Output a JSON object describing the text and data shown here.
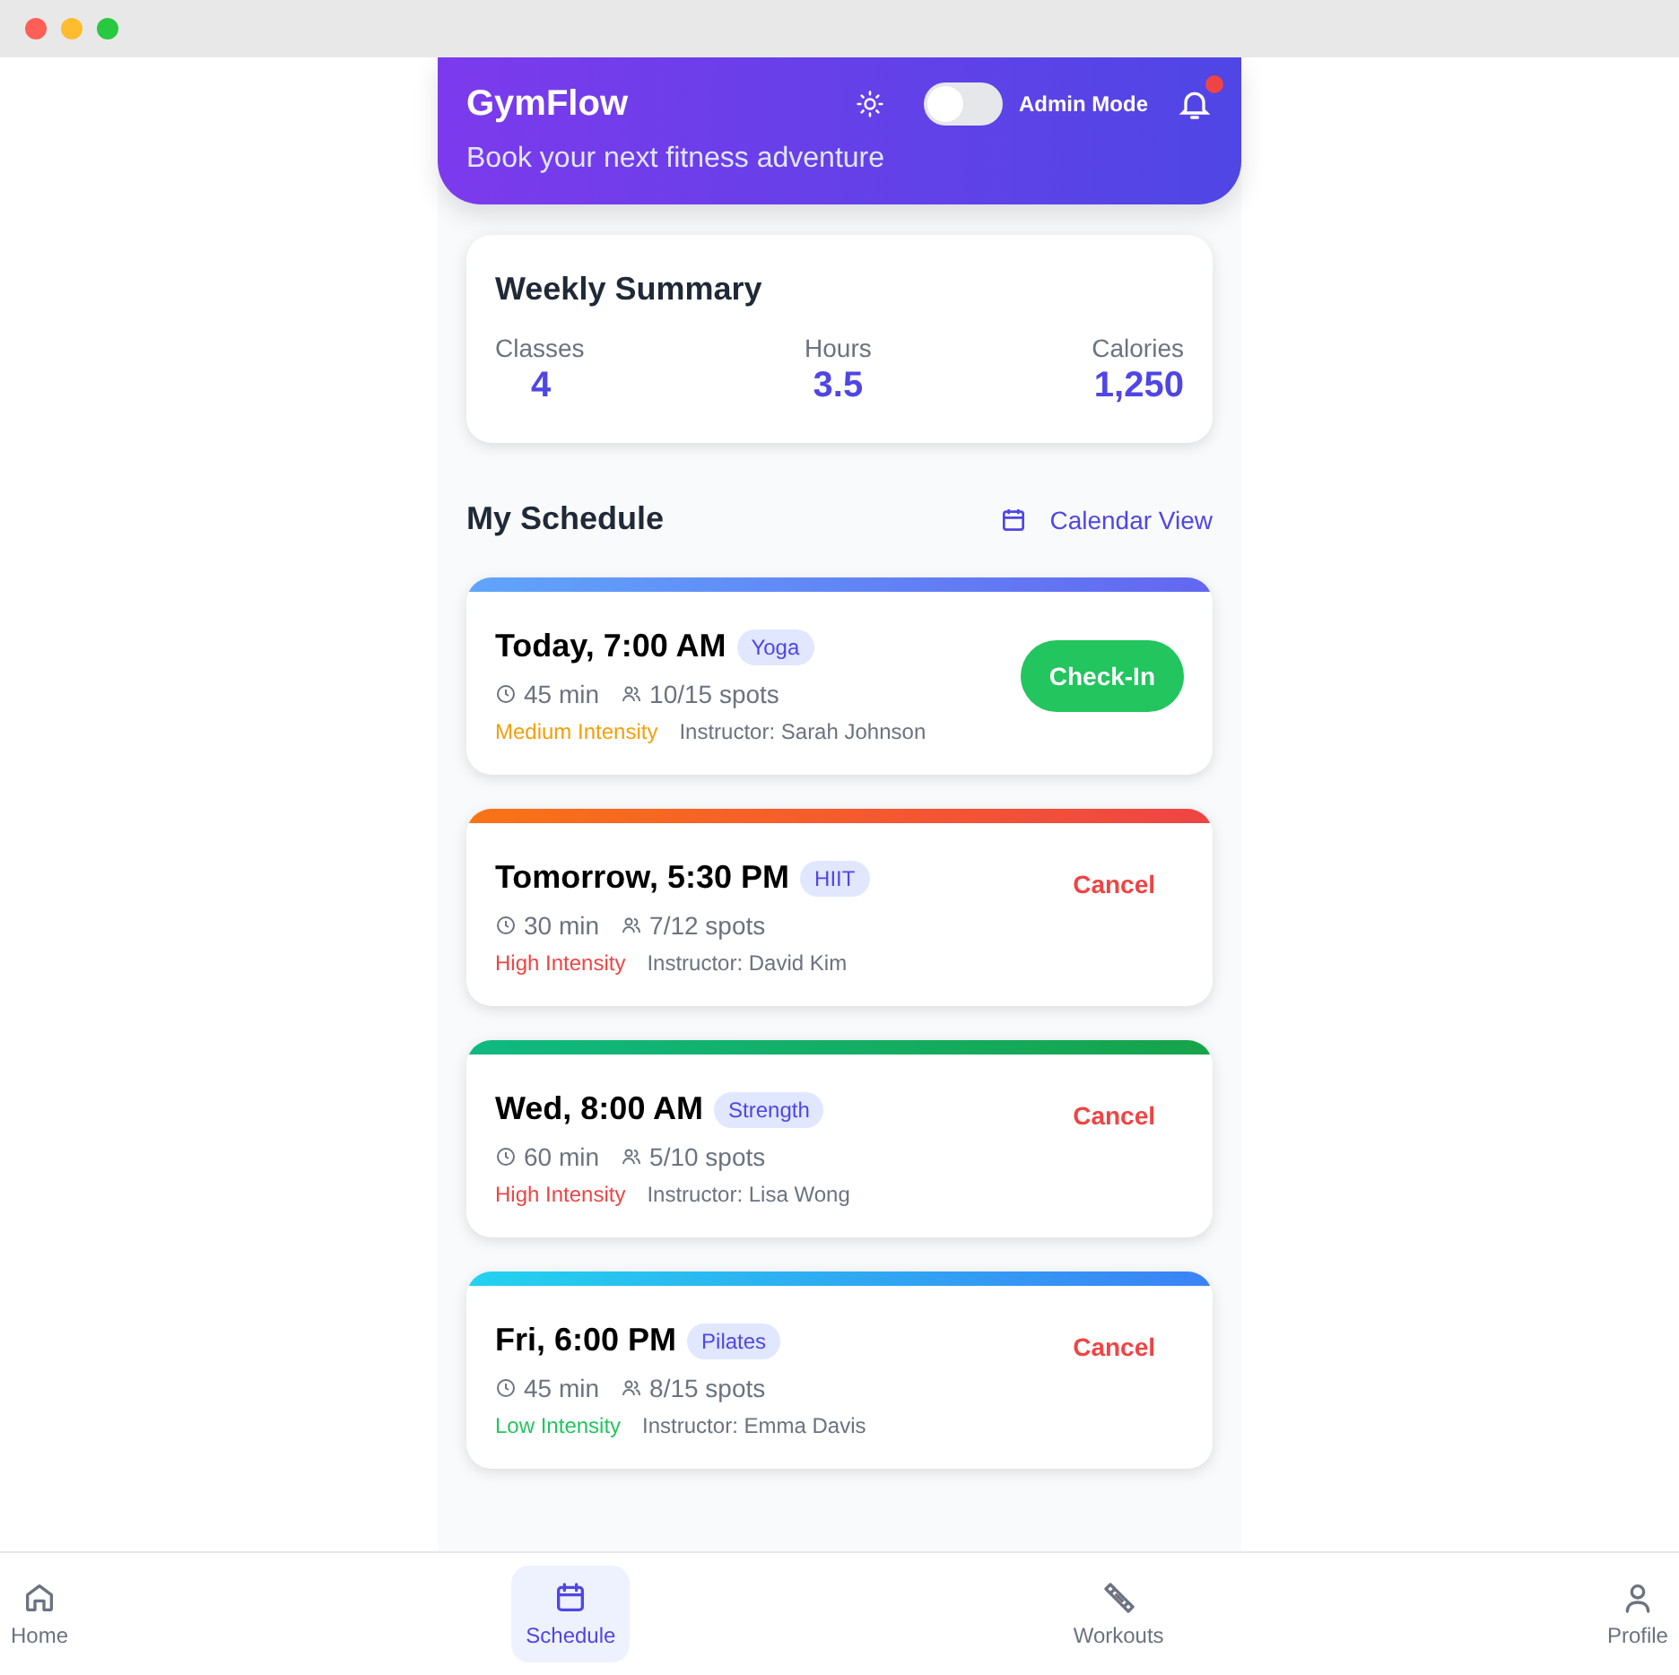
{
  "header": {
    "title": "GymFlow",
    "subtitle": "Book your next fitness adventure",
    "admin_toggle": {
      "label": "Admin Mode",
      "on": false
    },
    "notifications": {
      "unread": true
    }
  },
  "summary": {
    "title": "Weekly Summary",
    "stats": [
      {
        "label": "Classes",
        "value": "4"
      },
      {
        "label": "Hours",
        "value": "3.5"
      },
      {
        "label": "Calories",
        "value": "1,250"
      }
    ]
  },
  "schedule": {
    "title": "My Schedule",
    "calendar_link": "Calendar View",
    "classes": [
      {
        "time": "Today, 7:00 AM",
        "tag": "Yoga",
        "duration": "45 min",
        "spots": "10/15 spots",
        "intensity": {
          "text": "Medium Intensity",
          "color": "#f59e0b"
        },
        "instructor": "Instructor: Sarah Johnson",
        "action": {
          "kind": "checkin",
          "label": "Check-In"
        },
        "color": "#60a5fa"
      },
      {
        "time": "Tomorrow, 5:30 PM",
        "tag": "HIIT",
        "duration": "30 min",
        "spots": "7/12 spots",
        "intensity": {
          "text": "High Intensity",
          "color": "#ef4444"
        },
        "instructor": "Instructor: David Kim",
        "action": {
          "kind": "cancel",
          "label": "Cancel"
        },
        "color": "#f97316"
      },
      {
        "time": "Wed, 8:00 AM",
        "tag": "Strength",
        "duration": "60 min",
        "spots": "5/10 spots",
        "intensity": {
          "text": "High Intensity",
          "color": "#ef4444"
        },
        "instructor": "Instructor: Lisa Wong",
        "action": {
          "kind": "cancel",
          "label": "Cancel"
        },
        "color": "#10b981"
      },
      {
        "time": "Fri, 6:00 PM",
        "tag": "Pilates",
        "duration": "45 min",
        "spots": "8/15 spots",
        "intensity": {
          "text": "Low Intensity",
          "color": "#22c55e"
        },
        "instructor": "Instructor: Emma Davis",
        "action": {
          "kind": "cancel",
          "label": "Cancel"
        },
        "color": "#22d3ee"
      }
    ]
  },
  "nav": [
    {
      "label": "Home",
      "selected": false
    },
    {
      "label": "Schedule",
      "selected": true
    },
    {
      "label": "Workouts",
      "selected": false
    },
    {
      "label": "Profile",
      "selected": false
    }
  ]
}
